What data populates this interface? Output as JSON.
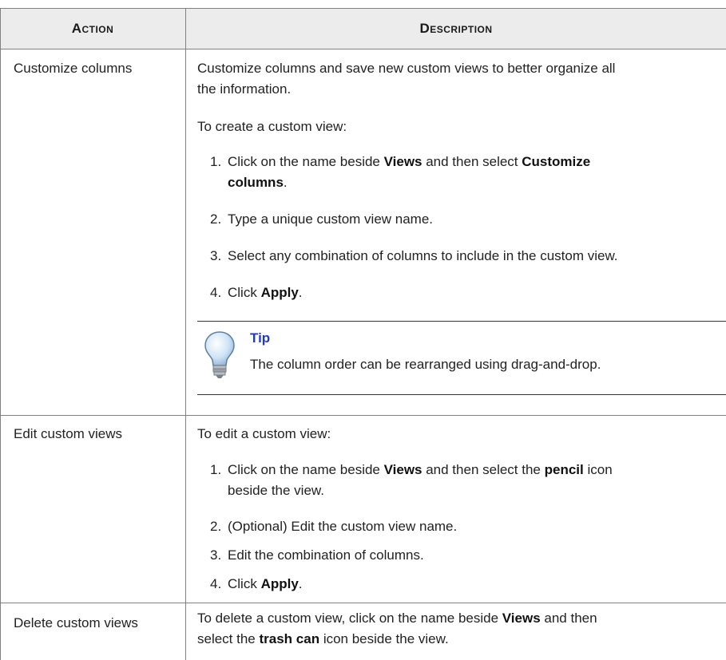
{
  "table": {
    "headers": {
      "action": "Action",
      "description": "Description"
    },
    "rows": [
      {
        "action": "Customize columns",
        "intro": "Customize columns and save new custom views to better organize all the information.",
        "intro_line1": "Customize columns and save new custom views to better organize all",
        "intro_line2": "the information.",
        "lead": "To create a custom view:",
        "steps": [
          {
            "num": "1.",
            "pre": "Click on the name beside ",
            "b1": "Views",
            "mid": " and then select ",
            "b2": "Customize",
            "line2b": "columns",
            "end": "."
          },
          {
            "num": "2.",
            "text": "Type a unique custom view name."
          },
          {
            "num": "3.",
            "text": "Select any combination of columns to include in the custom view."
          },
          {
            "num": "4.",
            "pre": "Click ",
            "b1": "Apply",
            "end": "."
          }
        ],
        "tip": {
          "title": "Tip",
          "text": "The column order can be rearranged using drag-and-drop."
        }
      },
      {
        "action": "Edit custom views",
        "lead": "To edit a custom view:",
        "steps": [
          {
            "num": "1.",
            "pre": "Click on the name beside ",
            "b1": "Views",
            "mid": " and then select the ",
            "b2": "pencil",
            "post": " icon",
            "line2": "beside the view."
          },
          {
            "num": "2.",
            "text": "(Optional) Edit the custom view name."
          },
          {
            "num": "3.",
            "text": "Edit the combination of columns."
          },
          {
            "num": "4.",
            "pre": "Click ",
            "b1": "Apply",
            "end": "."
          }
        ]
      },
      {
        "action": "Delete custom views",
        "line1_pre": "To delete a custom view, click on the name beside ",
        "line1_b": "Views",
        "line1_post": " and then",
        "line2_pre": "select the ",
        "line2_b": "trash can",
        "line2_post": " icon beside the view."
      }
    ]
  },
  "colors": {
    "tip_title": "#1f37d6",
    "header_bg": "#ececec",
    "border": "#808080"
  },
  "icons": {
    "tip": "lightbulb-icon"
  }
}
